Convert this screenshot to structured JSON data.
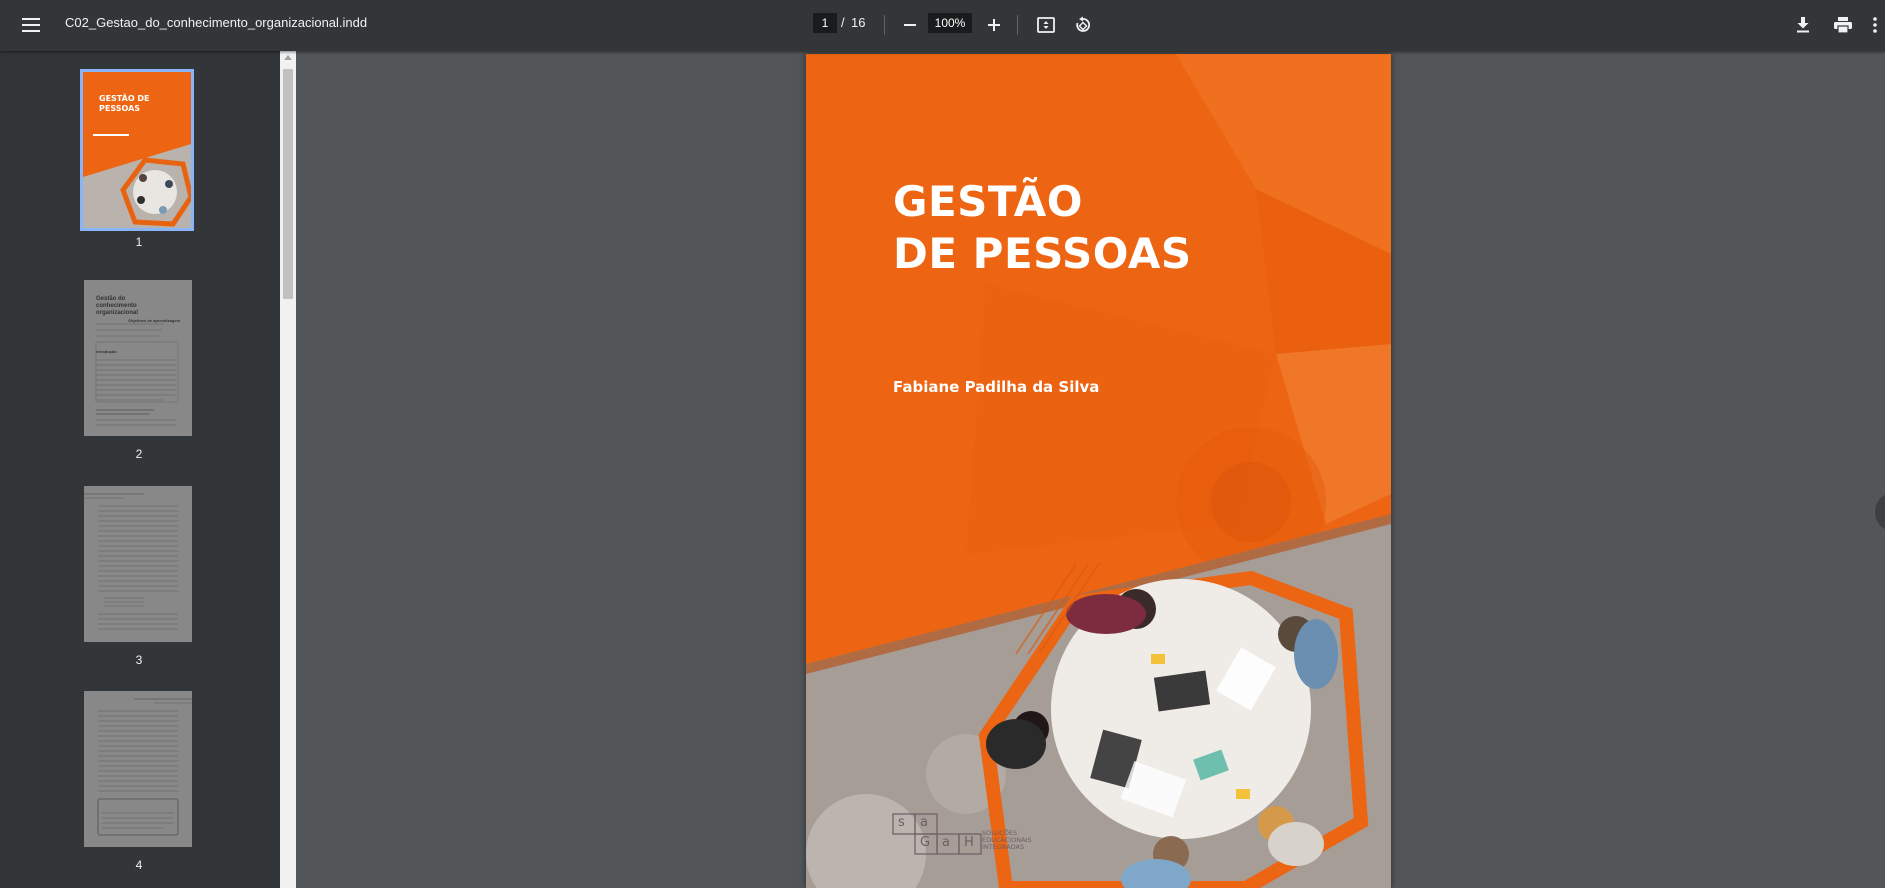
{
  "toolbar": {
    "file_title": "C02_Gestao_do_conhecimento_organizacional.indd",
    "current_page": "1",
    "page_separator": "/",
    "total_pages": "16",
    "zoom": "100%",
    "icons": [
      "menu-icon",
      "zoom-out-icon",
      "zoom-in-icon",
      "fit-page-icon",
      "rotate-icon",
      "download-icon",
      "print-icon",
      "more-vert-icon"
    ]
  },
  "sidebar": {
    "thumbnails": [
      {
        "label": "1",
        "selected": true
      },
      {
        "label": "2",
        "selected": false
      },
      {
        "label": "3",
        "selected": false
      },
      {
        "label": "4",
        "selected": false
      }
    ],
    "thumb2_heading": "Gestão do conhecimento organizacional",
    "thumb2_subheading": "Objetivos de aprendizagem",
    "thumb2_intro": "Introdução",
    "thumb1_title": "GESTÃO DE PESSOAS"
  },
  "document": {
    "title_line1": "GESTÃO",
    "title_line2": "DE PESSOAS",
    "author": "Fabiane Padilha da Silva",
    "logo_letters": [
      "s",
      "a",
      "G",
      "a",
      "H"
    ],
    "logo_tagline_line1": "SOLUÇÕES",
    "logo_tagline_line2": "EDUCACIONAIS",
    "logo_tagline_line3": "INTEGRADAS"
  },
  "colors": {
    "toolbar_bg": "#323639",
    "viewer_bg": "#525659",
    "cover_orange": "#ed6512",
    "selection": "#8ab4f8"
  }
}
